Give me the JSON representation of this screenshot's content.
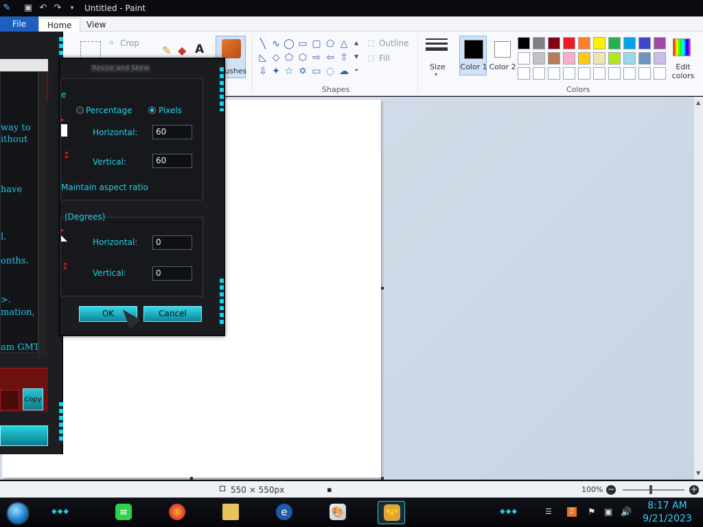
{
  "window": {
    "title": "Untitled - Paint"
  },
  "quick_access": {
    "icons": [
      "paint-app-icon",
      "save-icon",
      "undo-icon",
      "redo-icon",
      "customize-icon"
    ]
  },
  "ribbon_tabs": {
    "file": "File",
    "home": "Home",
    "view": "View"
  },
  "ribbon": {
    "crop_label": "Crop",
    "brushes_label": "Brushes",
    "shapes_group_label": "Shapes",
    "outline_label": "Outline",
    "fill_label": "Fill",
    "size_label": "Size",
    "color1_label": "Color 1",
    "color2_label": "Color 2",
    "edit_colors_label": "Edit colors",
    "colors_group_label": "Colors",
    "color1_value": "#000000",
    "color2_value": "#ffffff",
    "palette_row1": [
      "#000000",
      "#7f7f7f",
      "#880015",
      "#ed1c24",
      "#ff7f27",
      "#fff200",
      "#22b14c",
      "#00a2e8",
      "#3f48cc",
      "#a349a4"
    ],
    "palette_row2": [
      "#ffffff",
      "#c3c3c3",
      "#b97a57",
      "#ffaec9",
      "#ffc90e",
      "#efe4b0",
      "#b5e61d",
      "#99d9ea",
      "#7092be",
      "#c8bfe7"
    ],
    "palette_row3": [
      "#ffffff",
      "#ffffff",
      "#ffffff",
      "#ffffff",
      "#ffffff",
      "#ffffff",
      "#ffffff",
      "#ffffff",
      "#ffffff",
      "#ffffff"
    ]
  },
  "dialog": {
    "title": "Resize and Skew",
    "resize_section": "e",
    "percentage_label": "Percentage",
    "pixels_label": "Pixels",
    "resize_by": "Pixels",
    "horizontal_label": "Horizontal:",
    "vertical_label": "Vertical:",
    "resize_horizontal": "60",
    "resize_vertical": "60",
    "maintain_aspect": "Maintain aspect ratio",
    "skew_section": "(Degrees)",
    "skew_horizontal": "0",
    "skew_vertical": "0",
    "ok_label": "OK",
    "cancel_label": "Cancel"
  },
  "left_window": {
    "lines": [
      "way to",
      "ithout",
      "have",
      "l.",
      "onths.",
      ">.",
      "mation,",
      "am GMT"
    ],
    "copy_label": "Copy"
  },
  "statusbar": {
    "dimensions": "550 × 550px",
    "zoom": "100%"
  },
  "clock": {
    "time": "8:17 AM",
    "date": "9/21/2023"
  }
}
